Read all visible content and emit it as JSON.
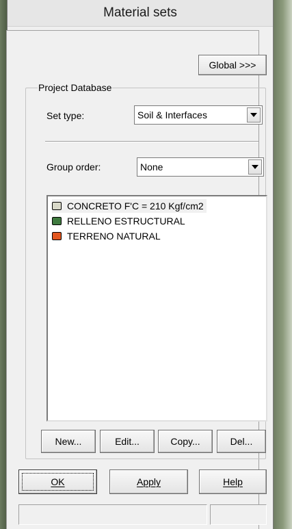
{
  "window": {
    "title": "Material sets"
  },
  "buttons": {
    "global": "Global >>>",
    "new": "New...",
    "edit": "Edit...",
    "copy": "Copy...",
    "del": "Del...",
    "ok": "OK",
    "apply": "Apply",
    "help": "Help"
  },
  "group": {
    "title": "Project Database"
  },
  "set_type": {
    "label": "Set type:",
    "value": "Soil & Interfaces"
  },
  "group_order": {
    "label": "Group order:",
    "value": "None"
  },
  "materials": [
    {
      "name": "CONCRETO F'C = 210 Kgf/cm2",
      "color": "#d9d9c9",
      "selected": true
    },
    {
      "name": "RELLENO ESTRUCTURAL",
      "color": "#3f7a3f",
      "selected": false
    },
    {
      "name": "TERRENO NATURAL",
      "color": "#e2561f",
      "selected": false
    }
  ],
  "statusbar": {
    "pane1": "",
    "pane2": ""
  }
}
